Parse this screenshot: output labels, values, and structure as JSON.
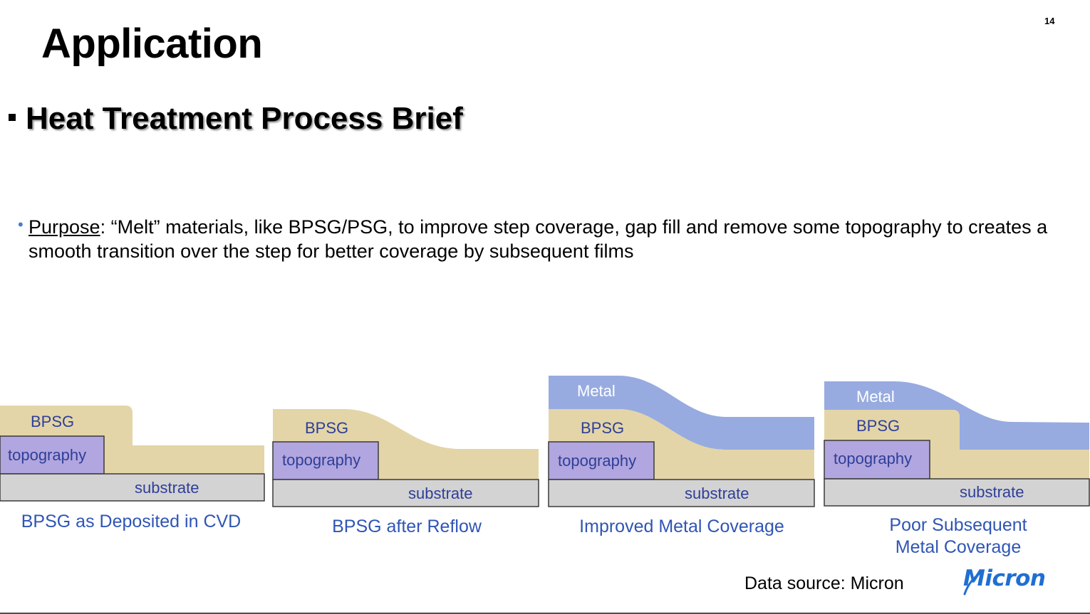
{
  "slide": {
    "title": "Application",
    "page_number": "14",
    "section_heading": "Heat Treatment Process Brief",
    "purpose_label": "Purpose",
    "purpose_text": ": “Melt” materials, like BPSG/PSG, to improve step coverage, gap fill and remove some topography to creates a smooth transition over the step for better coverage by subsequent films",
    "data_source": "Data source: Micron",
    "logo_text": "Micron"
  },
  "colors": {
    "bpsg": "#e3d5a7",
    "topography": "#b1a6df",
    "substrate": "#d3d3d3",
    "metal": "#97abe0",
    "label_text": "#2f3e99",
    "caption_text": "#2f55b5",
    "bullet": "#4a7bd0"
  },
  "diagrams": [
    {
      "bpsg_label": "BPSG",
      "topography_label": "topography",
      "substrate_label": "substrate",
      "caption_lines": [
        "BPSG as Deposited in CVD"
      ]
    },
    {
      "bpsg_label": "BPSG",
      "topography_label": "topography",
      "substrate_label": "substrate",
      "caption_lines": [
        "BPSG after Reflow"
      ]
    },
    {
      "metal_label": "Metal",
      "bpsg_label": "BPSG",
      "topography_label": "topography",
      "substrate_label": "substrate",
      "caption_lines": [
        "Improved Metal Coverage"
      ]
    },
    {
      "metal_label": "Metal",
      "bpsg_label": "BPSG",
      "topography_label": "topography",
      "substrate_label": "substrate",
      "caption_lines": [
        "Poor Subsequent",
        "Metal Coverage"
      ]
    }
  ]
}
